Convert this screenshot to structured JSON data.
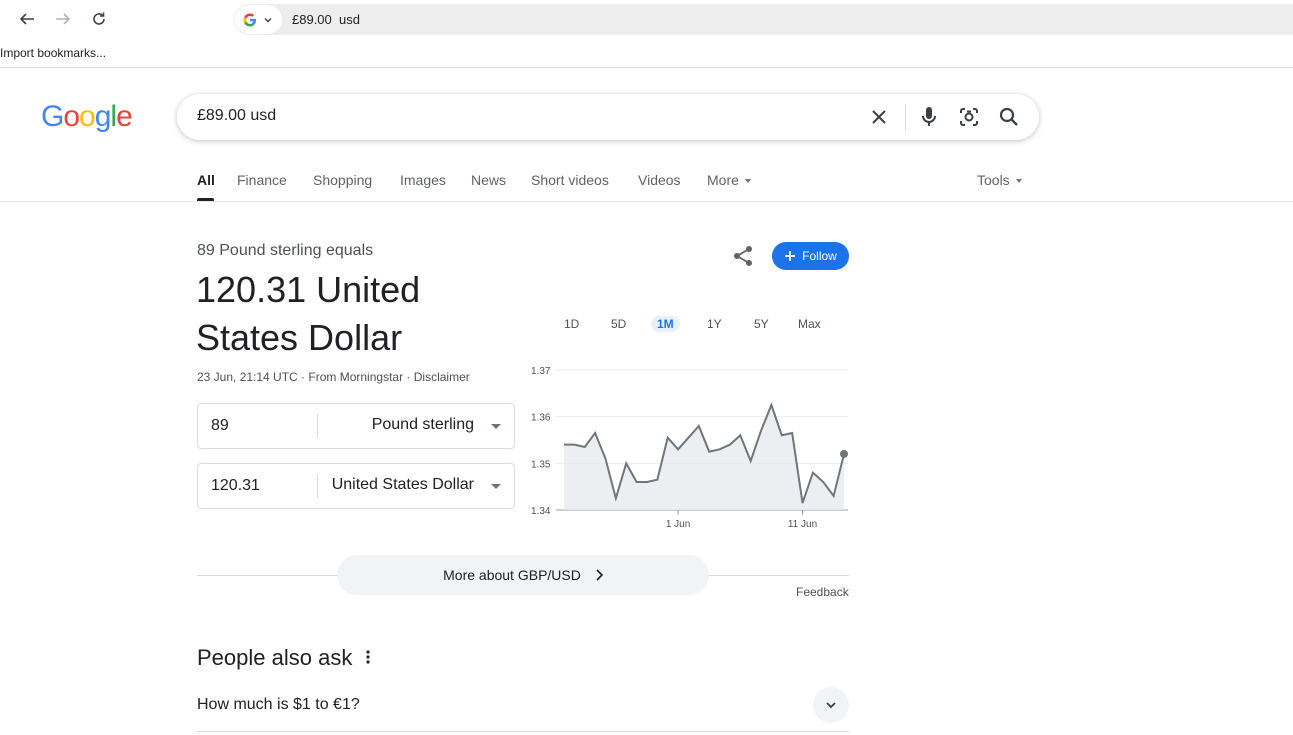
{
  "browser": {
    "address": "£89.00  usd",
    "bookmarks_item": "Import bookmarks..."
  },
  "search": {
    "query": "£89.00 usd"
  },
  "tabs": [
    {
      "label": "All"
    },
    {
      "label": "Finance"
    },
    {
      "label": "Shopping"
    },
    {
      "label": "Images"
    },
    {
      "label": "News"
    },
    {
      "label": "Short videos"
    },
    {
      "label": "Videos"
    },
    {
      "label": "More"
    }
  ],
  "tools_label": "Tools",
  "converter": {
    "equals_label": "89 Pound sterling equals",
    "result": "120.31 United States Dollar",
    "meta": "23 Jun, 21:14 UTC · From Morningstar · Disclaimer",
    "from_value": "89",
    "from_currency": "Pound sterling",
    "to_value": "120.31",
    "to_currency": "United States Dollar",
    "follow_label": "Follow",
    "ranges": [
      "1D",
      "5D",
      "1M",
      "1Y",
      "5Y",
      "Max"
    ],
    "active_range": "1M",
    "more_label": "More about GBP/USD",
    "feedback_label": "Feedback"
  },
  "chart_data": {
    "type": "area",
    "title": "",
    "xlabel": "",
    "ylabel": "",
    "ylim": [
      1.34,
      1.37
    ],
    "yticks": [
      "1.37",
      "1.36",
      "1.35",
      "1.34"
    ],
    "xticks": [
      {
        "label": "1 Jun",
        "index": 11
      },
      {
        "label": "11 Jun",
        "index": 23
      }
    ],
    "values": [
      1.354,
      1.354,
      1.3535,
      1.3565,
      1.351,
      1.3425,
      1.35,
      1.346,
      1.346,
      1.3465,
      1.3555,
      1.353,
      1.3555,
      1.358,
      1.3525,
      1.353,
      1.354,
      1.356,
      1.3505,
      1.357,
      1.3625,
      1.356,
      1.3565,
      1.3415,
      1.348,
      1.346,
      1.343,
      1.352
    ],
    "colors": {
      "line": "#70757a",
      "fill": "#e8eaed",
      "grid": "#ebebeb"
    }
  },
  "people_also_ask": {
    "title": "People also ask",
    "questions": [
      "How much is $1 to €1?"
    ]
  }
}
